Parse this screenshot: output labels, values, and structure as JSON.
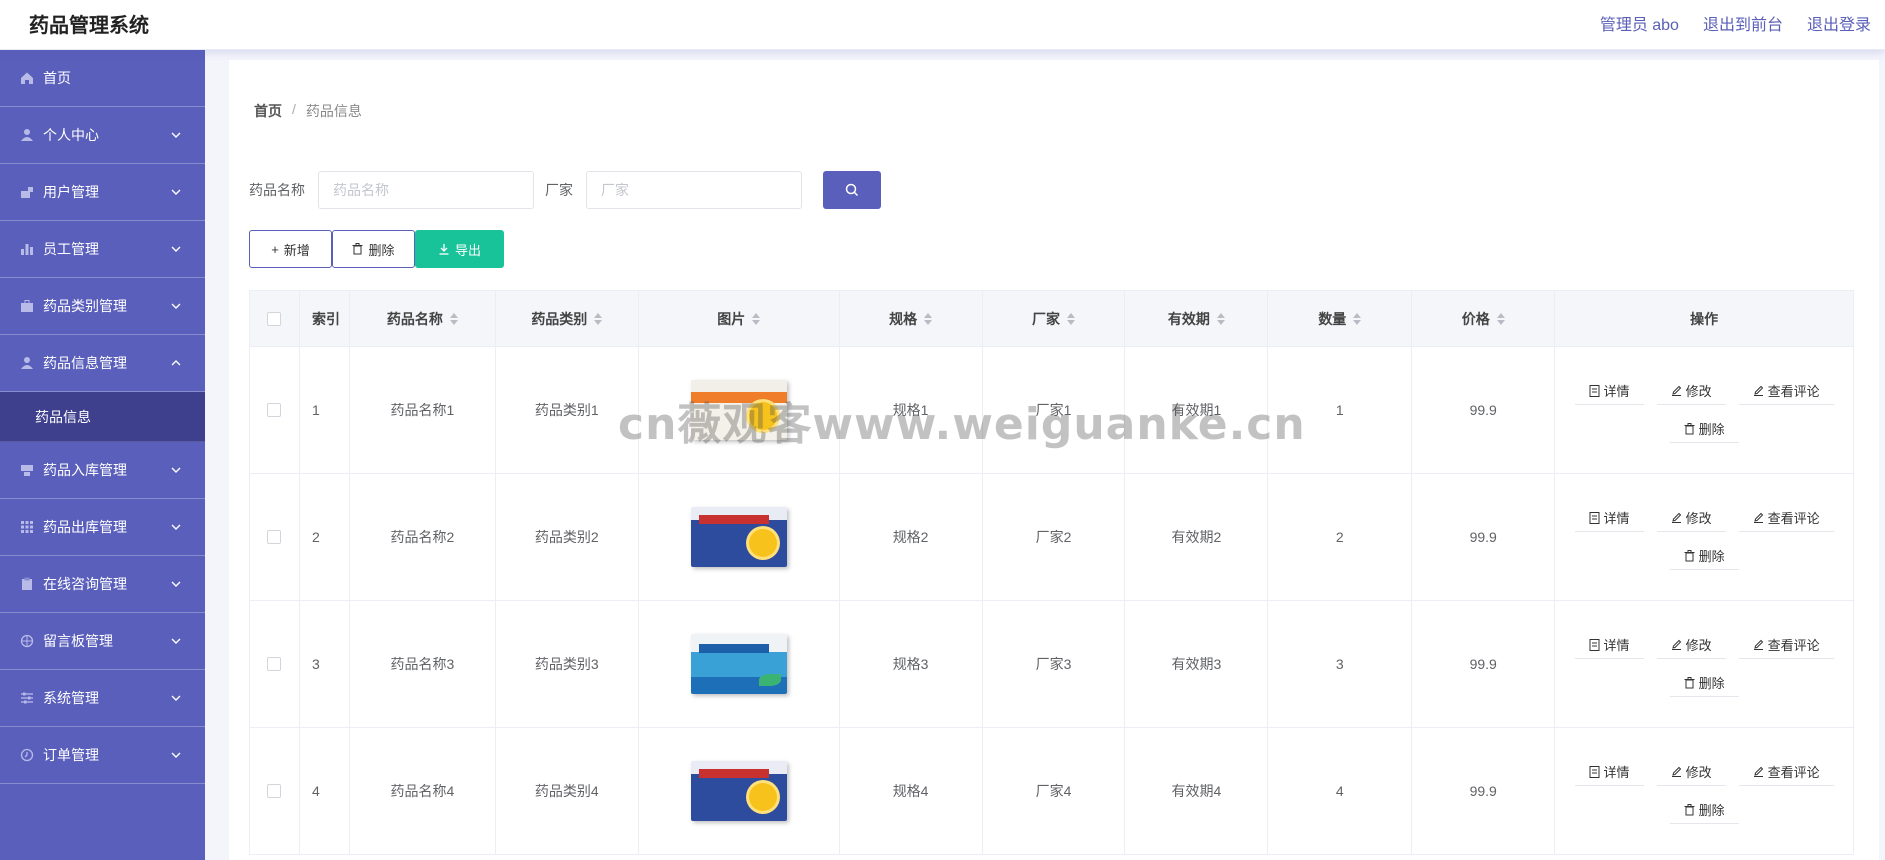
{
  "header": {
    "title": "药品管理系统",
    "admin_label": "管理员 abo",
    "front_label": "退出到前台",
    "logout_label": "退出登录"
  },
  "sidebar": {
    "items": [
      {
        "label": "首页",
        "icon": "home-icon",
        "expandable": false
      },
      {
        "label": "个人中心",
        "icon": "user-icon",
        "expandable": true
      },
      {
        "label": "用户管理",
        "icon": "user-manage-icon",
        "expandable": true
      },
      {
        "label": "员工管理",
        "icon": "bar-chart-icon",
        "expandable": true
      },
      {
        "label": "药品类别管理",
        "icon": "briefcase-icon",
        "expandable": true
      },
      {
        "label": "药品信息管理",
        "icon": "user-icon",
        "expandable": true,
        "open": true
      },
      {
        "label": "药品入库管理",
        "icon": "inbox-icon",
        "expandable": true
      },
      {
        "label": "药品出库管理",
        "icon": "grid-icon",
        "expandable": true
      },
      {
        "label": "在线咨询管理",
        "icon": "clipboard-icon",
        "expandable": true
      },
      {
        "label": "留言板管理",
        "icon": "compass-icon",
        "expandable": true
      },
      {
        "label": "系统管理",
        "icon": "sliders-icon",
        "expandable": true
      },
      {
        "label": "订单管理",
        "icon": "clock-icon",
        "expandable": true
      }
    ],
    "active_sub_label": "药品信息"
  },
  "breadcrumb": {
    "home": "首页",
    "current": "药品信息"
  },
  "search": {
    "name_label": "药品名称",
    "name_placeholder": "药品名称",
    "maker_label": "厂家",
    "maker_placeholder": "厂家"
  },
  "actions": {
    "add": "新增",
    "delete": "删除",
    "export": "导出"
  },
  "table": {
    "headers": [
      "索引",
      "药品名称",
      "药品类别",
      "图片",
      "规格",
      "厂家",
      "有效期",
      "数量",
      "价格",
      "操作"
    ],
    "op_labels": {
      "detail": "详情",
      "edit": "修改",
      "comments": "查看评论",
      "remove": "删除"
    },
    "rows": [
      {
        "index": "1",
        "name": "药品名称1",
        "category": "药品类别1",
        "image": "orange-box",
        "spec": "规格1",
        "maker": "厂家1",
        "expiry": "有效期1",
        "qty": "1",
        "price": "99.9"
      },
      {
        "index": "2",
        "name": "药品名称2",
        "category": "药品类别2",
        "image": "blue-box",
        "spec": "规格2",
        "maker": "厂家2",
        "expiry": "有效期2",
        "qty": "2",
        "price": "99.9"
      },
      {
        "index": "3",
        "name": "药品名称3",
        "category": "药品类别3",
        "image": "teal-box",
        "spec": "规格3",
        "maker": "厂家3",
        "expiry": "有效期3",
        "qty": "3",
        "price": "99.9"
      },
      {
        "index": "4",
        "name": "药品名称4",
        "category": "药品类别4",
        "image": "blue-box",
        "spec": "规格4",
        "maker": "厂家4",
        "expiry": "有效期4",
        "qty": "4",
        "price": "99.9"
      }
    ]
  },
  "watermark": "cn薇观客www.weiguanke.cn",
  "colors": {
    "primary": "#5a5fbb",
    "submenu": "#3e3f8d",
    "export": "#19c39a"
  }
}
